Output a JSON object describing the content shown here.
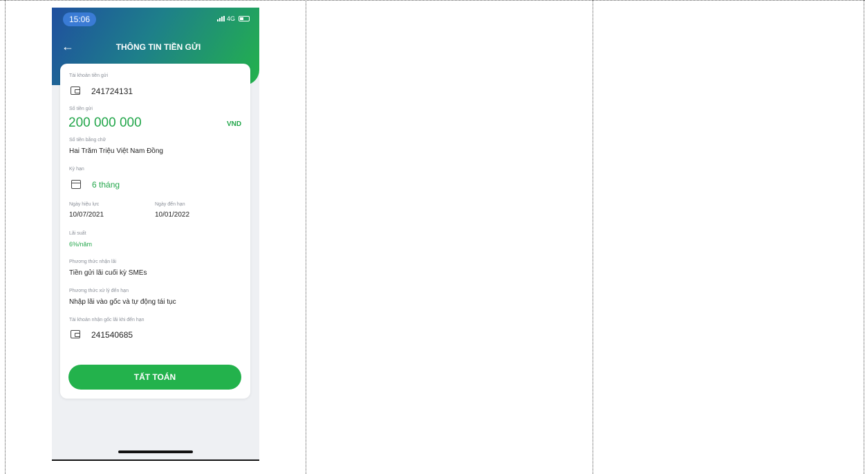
{
  "status": {
    "time": "15:06",
    "network": "4G"
  },
  "header": {
    "back_icon": "arrow-left-icon",
    "title": "THÔNG TIN TIỀN GỬI"
  },
  "deposit": {
    "account_label": "Tài khoản tiền gửi",
    "account": "241724131",
    "amount_label": "Số tiền gửi",
    "amount": "200 000 000",
    "currency": "VND",
    "amount_words_label": "Số tiền bằng chữ",
    "amount_words": "Hai Trăm Triệu Việt Nam Đồng",
    "term_label": "Kỳ hạn",
    "term": "6 tháng",
    "effective_label": "Ngày hiệu lực",
    "effective_date": "10/07/2021",
    "maturity_label": "Ngày đến hạn",
    "maturity_date": "10/01/2022",
    "rate_label": "Lãi suất",
    "rate": "6%/năm",
    "interest_method_label": "Phương thức nhận lãi",
    "interest_method": "Tiền gửi lãi cuối kỳ SMEs",
    "maturity_method_label": "Phương thức xử lý đến hạn",
    "maturity_method": "Nhập lãi vào gốc và tự động tái tục",
    "receive_account_label": "Tài khoản nhận gốc lãi khi đến hạn",
    "receive_account": "241540685"
  },
  "actions": {
    "settle_label": "TẤT TOÁN"
  },
  "colors": {
    "accent": "#23b24c",
    "header_start": "#1f4f9f",
    "header_end": "#23b24c"
  }
}
